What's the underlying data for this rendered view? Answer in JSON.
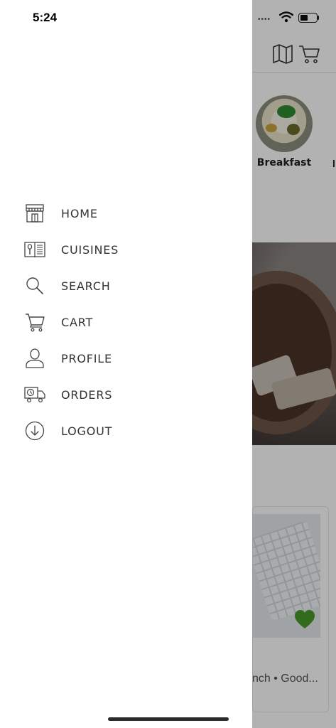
{
  "status_bar": {
    "time": "5:24"
  },
  "background": {
    "categories": [
      {
        "label": "Breakfast"
      }
    ],
    "card": {
      "subtitle": "nch • Good..."
    }
  },
  "drawer": {
    "menu": [
      {
        "label": "HOME",
        "icon": "store-icon"
      },
      {
        "label": "CUISINES",
        "icon": "menu-book-icon"
      },
      {
        "label": "SEARCH",
        "icon": "search-icon"
      },
      {
        "label": "CART",
        "icon": "cart-icon"
      },
      {
        "label": "PROFILE",
        "icon": "user-icon"
      },
      {
        "label": "ORDERS",
        "icon": "delivery-truck-icon"
      },
      {
        "label": "LOGOUT",
        "icon": "logout-icon"
      }
    ]
  },
  "colors": {
    "favorite": "#4a9a2a",
    "overlay": "rgba(0,0,0,0.30)"
  }
}
